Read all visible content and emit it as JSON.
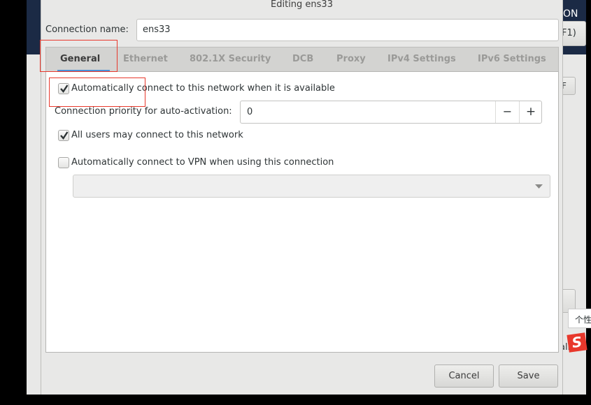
{
  "background": {
    "top_right_text": "ON",
    "shortcut_text": "F1)",
    "side_button_text": "F",
    "partial_text": "alh",
    "tooltip_text": "个性"
  },
  "dialog": {
    "title": "Editing ens33",
    "connection_name_label": "Connection name:",
    "connection_name_value": "ens33",
    "tabs": [
      {
        "label": "General",
        "active": true
      },
      {
        "label": "Ethernet"
      },
      {
        "label": "802.1X Security"
      },
      {
        "label": "DCB"
      },
      {
        "label": "Proxy"
      },
      {
        "label": "IPv4 Settings"
      },
      {
        "label": "IPv6 Settings"
      }
    ],
    "general": {
      "auto_connect": {
        "label": "Automatically connect to this network when it is available",
        "checked": true
      },
      "priority": {
        "label": "Connection priority for auto-activation:",
        "value": "0",
        "minus": "−",
        "plus": "+"
      },
      "all_users": {
        "label": "All users may connect to this network",
        "checked": true
      },
      "vpn": {
        "label": "Automatically connect to VPN when using this connection",
        "checked": false
      },
      "vpn_select_value": ""
    },
    "buttons": {
      "cancel": "Cancel",
      "save": "Save"
    }
  },
  "colors": {
    "annotation": "#e8382c",
    "tab_underline": "#4a90d9",
    "navy": "#1b2a45"
  }
}
